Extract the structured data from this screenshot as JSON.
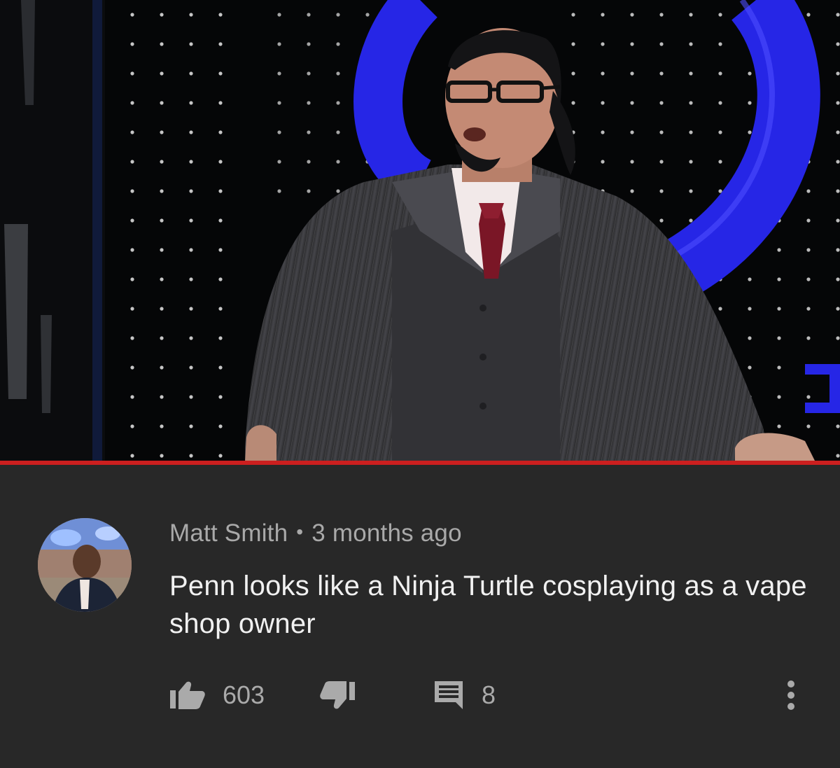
{
  "video": {
    "progress": 1.0,
    "colors": {
      "backdrop": "#050607",
      "stage_blue": "#2626e6",
      "suit": "#3b3b3d",
      "tie": "#7a1626",
      "progress_bar": "#cc1f1f"
    }
  },
  "comment": {
    "author": "Matt Smith",
    "separator": "•",
    "time": "3 months ago",
    "text": "Penn looks like a Ninja Turtle cosplaying as a vape shop owner",
    "likes": "603",
    "replies": "8"
  },
  "icons": {
    "like": "thumbs-up-icon",
    "dislike": "thumbs-down-icon",
    "reply": "reply-comment-icon",
    "more": "more-vertical-icon"
  },
  "colors": {
    "background": "#282828",
    "meta_text": "#a9a9a9",
    "body_text": "#f1f1f1",
    "icon": "#aaaaaa"
  }
}
